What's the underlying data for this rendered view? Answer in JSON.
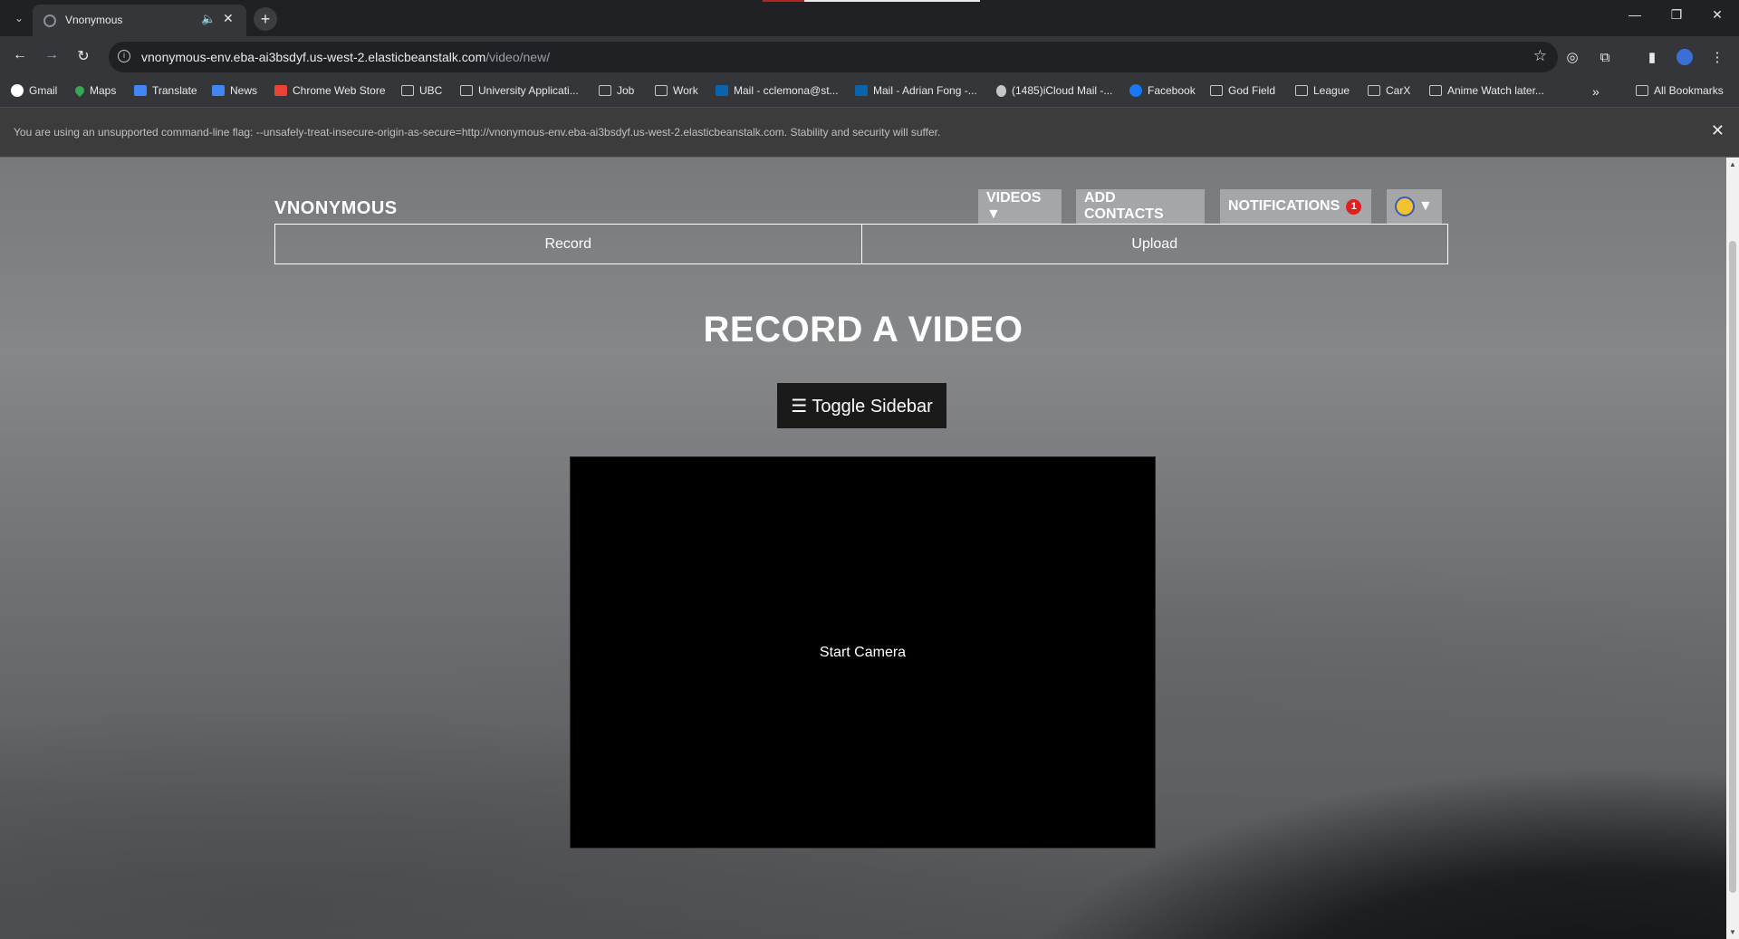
{
  "browser": {
    "tab_title": "Vnonymous",
    "new_tab_symbol": "+",
    "url_host": "vnonymous-env.eba-ai3bsdyf.us-west-2.elasticbeanstalk.com",
    "url_path": "/video/new/",
    "bookmarks": [
      "Gmail",
      "Maps",
      "Translate",
      "News",
      "Chrome Web Store",
      "UBC",
      "University Applicati...",
      "Job",
      "Work",
      "Mail - cclemona@st...",
      "Mail - Adrian Fong -...",
      "(1485)iCloud Mail -...",
      "Facebook",
      "God Field",
      "League",
      "CarX",
      "Anime Watch later..."
    ],
    "bookmarks_overflow": "»",
    "all_bookmarks": "All Bookmarks",
    "infobar_message": "You are using an unsupported command-line flag: --unsafely-treat-insecure-origin-as-secure=http://vnonymous-env.eba-ai3bsdyf.us-west-2.elasticbeanstalk.com. Stability and security will suffer."
  },
  "site": {
    "brand": "VNONYMOUS",
    "nav": {
      "videos": "VIDEOS ▼",
      "add_contacts": "ADD CONTACTS",
      "notifications": "NOTIFICATIONS",
      "notification_count": "1",
      "profile_caret": "▼"
    },
    "tabs": [
      "Record",
      "Upload"
    ],
    "heading": "RECORD A VIDEO",
    "toggle_sidebar": "☰ Toggle Sidebar",
    "start_camera": "Start Camera"
  },
  "colors": {
    "notification_badge": "#e02020",
    "video_box": "#000000",
    "toggle_button": "#1a1a1a"
  }
}
